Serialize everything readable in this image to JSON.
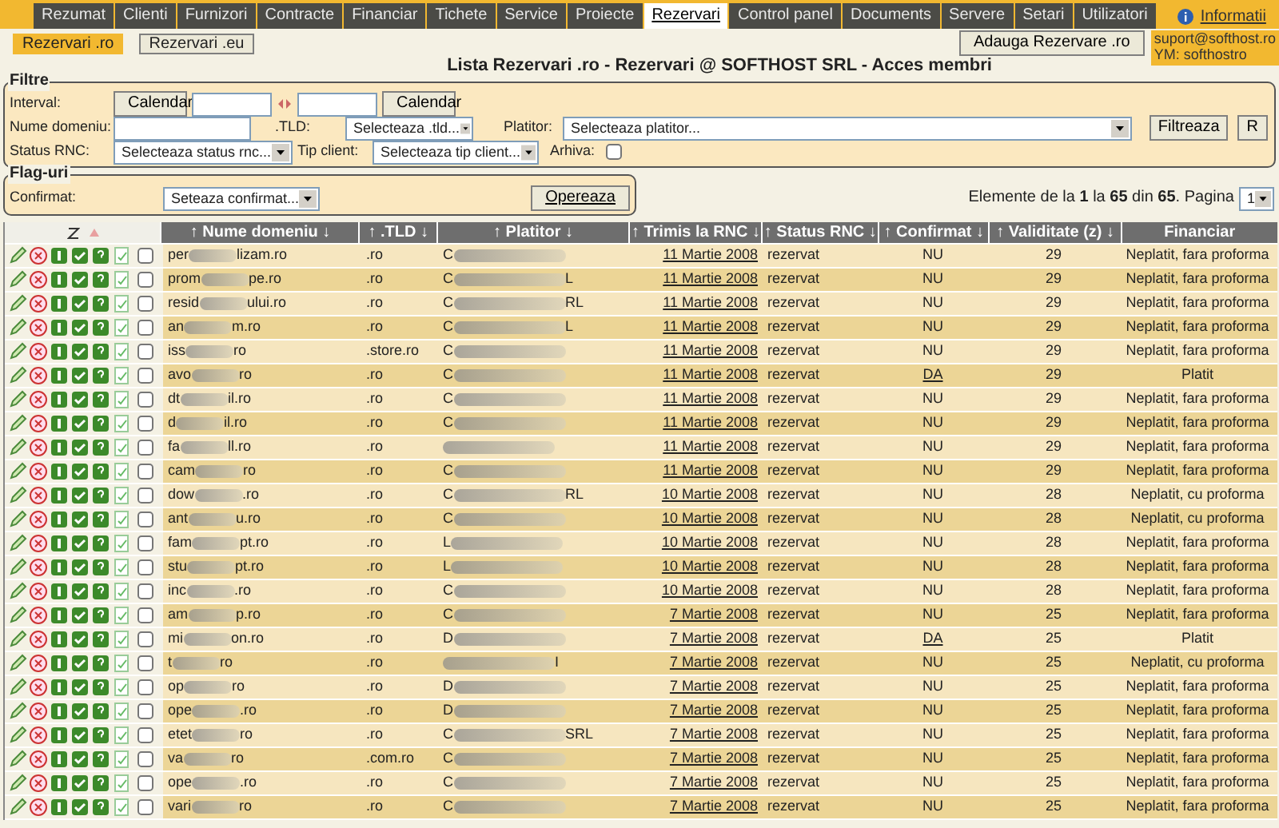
{
  "tabs": [
    {
      "label": "Rezumat",
      "selected": false
    },
    {
      "label": "Clienti",
      "selected": false
    },
    {
      "label": "Furnizori",
      "selected": false
    },
    {
      "label": "Contracte",
      "selected": false
    },
    {
      "label": "Financiar",
      "selected": false
    },
    {
      "label": "Tichete",
      "selected": false
    },
    {
      "label": "Service",
      "selected": false
    },
    {
      "label": "Proiecte",
      "selected": false
    },
    {
      "label": "Rezervari",
      "selected": true
    },
    {
      "label": "Control panel",
      "selected": false
    },
    {
      "label": "Documents",
      "selected": false
    },
    {
      "label": "Servere",
      "selected": false
    },
    {
      "label": "Setari",
      "selected": false
    },
    {
      "label": "Utilizatori",
      "selected": false
    }
  ],
  "info_link": "Informatii",
  "subtabs": [
    {
      "label": "Rezervari .ro",
      "selected": true
    },
    {
      "label": "Rezervari .eu",
      "selected": false
    }
  ],
  "add_button": "Adauga Rezervare .ro",
  "contact": [
    "suport@softhost.ro",
    "YM: softhostro"
  ],
  "title": "Lista Rezervari .ro - Rezervari @ SOFTHOST SRL - Acces membri",
  "filters": {
    "legend": "Filtre",
    "interval_label": "Interval:",
    "calendar_buttons": [
      "Calendar",
      "Calendar"
    ],
    "domain_label": "Nume domeniu:",
    "tld_label": ".TLD:",
    "tld_select": "Selecteaza .tld...",
    "payer_label": "Platitor:",
    "payer_select": "Selecteaza platitor...",
    "filter_button": "Filtreaza",
    "reset_button": "R",
    "status_label": "Status RNC:",
    "status_select": "Selecteaza status rnc...",
    "client_label": "Tip client:",
    "client_select": "Selecteaza tip client...",
    "archive_label": "Arhiva:",
    "archive_checked": false
  },
  "flags": {
    "legend": "Flag-uri",
    "confirmed_label": "Confirmat:",
    "confirmed_select": "Seteaza confirmat...",
    "apply_button": "Opereaza"
  },
  "pagination": {
    "text": "Elemente de la **1** la **65** din **65**. Pagina",
    "page": "1"
  },
  "table": {
    "columns": [
      "↑ Nume domeniu ↓",
      "↑ .TLD ↓",
      "↑ Platitor ↓",
      "↑ Trimis la RNC ↓",
      "↑ Status RNC ↓",
      "↑ Confirmat ↓",
      "↑ Validitate (z) ↓",
      "Financiar"
    ],
    "rows": [
      {
        "domain_start": "per",
        "domain_end": "lizam.ro",
        "tld": ".ro",
        "payer_start": "C",
        "payer_end": "",
        "sent": "11 Martie 2008",
        "status": "rezervat",
        "confirmed": "NU",
        "validity": "29",
        "financial": "Neplatit, fara proforma",
        "checked": false
      },
      {
        "domain_start": "prom",
        "domain_end": "pe.ro",
        "tld": ".ro",
        "payer_start": "C",
        "payer_end": "L",
        "sent": "11 Martie 2008",
        "status": "rezervat",
        "confirmed": "NU",
        "validity": "29",
        "financial": "Neplatit, fara proforma",
        "checked": false
      },
      {
        "domain_start": "resid",
        "domain_end": "ului.ro",
        "tld": ".ro",
        "payer_start": "C",
        "payer_end": "RL",
        "sent": "11 Martie 2008",
        "status": "rezervat",
        "confirmed": "NU",
        "validity": "29",
        "financial": "Neplatit, fara proforma",
        "checked": false
      },
      {
        "domain_start": "an",
        "domain_end": "m.ro",
        "tld": ".ro",
        "payer_start": "C",
        "payer_end": "L",
        "sent": "11 Martie 2008",
        "status": "rezervat",
        "confirmed": "NU",
        "validity": "29",
        "financial": "Neplatit, fara proforma",
        "checked": false
      },
      {
        "domain_start": "iss",
        "domain_end": "ro",
        "tld": ".store.ro",
        "payer_start": "C",
        "payer_end": "",
        "sent": "11 Martie 2008",
        "status": "rezervat",
        "confirmed": "NU",
        "validity": "29",
        "financial": "Neplatit, fara proforma",
        "checked": false
      },
      {
        "domain_start": "avo",
        "domain_end": "ro",
        "tld": ".ro",
        "payer_start": "C",
        "payer_end": "",
        "sent": "11 Martie 2008",
        "status": "rezervat",
        "confirmed": "DA",
        "validity": "29",
        "financial": "Platit",
        "checked": false
      },
      {
        "domain_start": "dt",
        "domain_end": "il.ro",
        "tld": ".ro",
        "payer_start": "C",
        "payer_end": "",
        "sent": "11 Martie 2008",
        "status": "rezervat",
        "confirmed": "NU",
        "validity": "29",
        "financial": "Neplatit, fara proforma",
        "checked": false
      },
      {
        "domain_start": "d",
        "domain_end": "il.ro",
        "tld": ".ro",
        "payer_start": "C",
        "payer_end": "",
        "sent": "11 Martie 2008",
        "status": "rezervat",
        "confirmed": "NU",
        "validity": "29",
        "financial": "Neplatit, fara proforma",
        "checked": false
      },
      {
        "domain_start": "fa",
        "domain_end": "ll.ro",
        "tld": ".ro",
        "payer_start": "",
        "payer_end": "",
        "sent": "11 Martie 2008",
        "status": "rezervat",
        "confirmed": "NU",
        "validity": "29",
        "financial": "Neplatit, fara proforma",
        "checked": false
      },
      {
        "domain_start": "cam",
        "domain_end": "ro",
        "tld": ".ro",
        "payer_start": "C",
        "payer_end": "",
        "sent": "11 Martie 2008",
        "status": "rezervat",
        "confirmed": "NU",
        "validity": "29",
        "financial": "Neplatit, fara proforma",
        "checked": false
      },
      {
        "domain_start": "dow",
        "domain_end": ".ro",
        "tld": ".ro",
        "payer_start": "C",
        "payer_end": "RL",
        "sent": "10 Martie 2008",
        "status": "rezervat",
        "confirmed": "NU",
        "validity": "28",
        "financial": "Neplatit, cu proforma",
        "checked": false
      },
      {
        "domain_start": "ant",
        "domain_end": "u.ro",
        "tld": ".ro",
        "payer_start": "C",
        "payer_end": "",
        "sent": "10 Martie 2008",
        "status": "rezervat",
        "confirmed": "NU",
        "validity": "28",
        "financial": "Neplatit, cu proforma",
        "checked": false
      },
      {
        "domain_start": "fam",
        "domain_end": "pt.ro",
        "tld": ".ro",
        "payer_start": "L",
        "payer_end": "",
        "sent": "10 Martie 2008",
        "status": "rezervat",
        "confirmed": "NU",
        "validity": "28",
        "financial": "Neplatit, fara proforma",
        "checked": false
      },
      {
        "domain_start": "stu",
        "domain_end": "pt.ro",
        "tld": ".ro",
        "payer_start": "L",
        "payer_end": "",
        "sent": "10 Martie 2008",
        "status": "rezervat",
        "confirmed": "NU",
        "validity": "28",
        "financial": "Neplatit, fara proforma",
        "checked": false
      },
      {
        "domain_start": "inc",
        "domain_end": ".ro",
        "tld": ".ro",
        "payer_start": "C",
        "payer_end": "",
        "sent": "10 Martie 2008",
        "status": "rezervat",
        "confirmed": "NU",
        "validity": "28",
        "financial": "Neplatit, fara proforma",
        "checked": false
      },
      {
        "domain_start": "am",
        "domain_end": "p.ro",
        "tld": ".ro",
        "payer_start": "C",
        "payer_end": "",
        "sent": "7 Martie 2008",
        "status": "rezervat",
        "confirmed": "NU",
        "validity": "25",
        "financial": "Neplatit, fara proforma",
        "checked": false
      },
      {
        "domain_start": "mi",
        "domain_end": "on.ro",
        "tld": ".ro",
        "payer_start": "D",
        "payer_end": "",
        "sent": "7 Martie 2008",
        "status": "rezervat",
        "confirmed": "DA",
        "validity": "25",
        "financial": "Platit",
        "checked": false
      },
      {
        "domain_start": "t",
        "domain_end": "ro",
        "tld": ".ro",
        "payer_start": "",
        "payer_end": "I",
        "sent": "7 Martie 2008",
        "status": "rezervat",
        "confirmed": "NU",
        "validity": "25",
        "financial": "Neplatit, cu proforma",
        "checked": false
      },
      {
        "domain_start": "op",
        "domain_end": "ro",
        "tld": ".ro",
        "payer_start": "D",
        "payer_end": "",
        "sent": "7 Martie 2008",
        "status": "rezervat",
        "confirmed": "NU",
        "validity": "25",
        "financial": "Neplatit, fara proforma",
        "checked": false
      },
      {
        "domain_start": "ope",
        "domain_end": ".ro",
        "tld": ".ro",
        "payer_start": "D",
        "payer_end": "",
        "sent": "7 Martie 2008",
        "status": "rezervat",
        "confirmed": "NU",
        "validity": "25",
        "financial": "Neplatit, fara proforma",
        "checked": false
      },
      {
        "domain_start": "etet",
        "domain_end": "ro",
        "tld": ".ro",
        "payer_start": "C",
        "payer_end": "SRL",
        "sent": "7 Martie 2008",
        "status": "rezervat",
        "confirmed": "NU",
        "validity": "25",
        "financial": "Neplatit, fara proforma",
        "checked": false
      },
      {
        "domain_start": "va",
        "domain_end": "ro",
        "tld": ".com.ro",
        "payer_start": "C",
        "payer_end": "",
        "sent": "7 Martie 2008",
        "status": "rezervat",
        "confirmed": "NU",
        "validity": "25",
        "financial": "Neplatit, fara proforma",
        "checked": false
      },
      {
        "domain_start": "ope",
        "domain_end": ".ro",
        "tld": ".ro",
        "payer_start": "C",
        "payer_end": "",
        "sent": "7 Martie 2008",
        "status": "rezervat",
        "confirmed": "NU",
        "validity": "25",
        "financial": "Neplatit, fara proforma",
        "checked": false
      },
      {
        "domain_start": "vari",
        "domain_end": "ro",
        "tld": ".ro",
        "payer_start": "C",
        "payer_end": "",
        "sent": "7 Martie 2008",
        "status": "rezervat",
        "confirmed": "NU",
        "validity": "25",
        "financial": "Neplatit, fara proforma",
        "checked": false
      }
    ]
  }
}
